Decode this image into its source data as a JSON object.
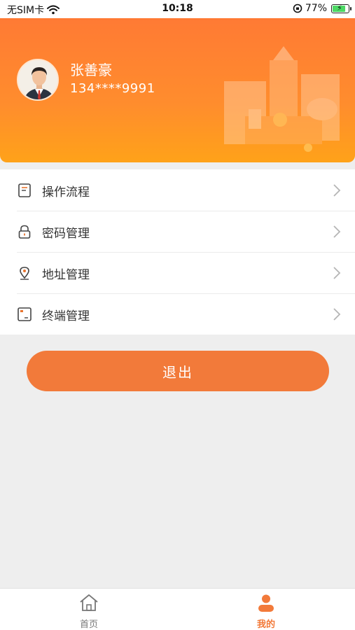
{
  "status_bar": {
    "carrier": "无SIM卡",
    "time": "10:18",
    "battery_percent": "77%",
    "battery_level": 0.77
  },
  "profile": {
    "name": "张善豪",
    "phone": "134****9991"
  },
  "menu": {
    "items": [
      {
        "label": "操作流程",
        "icon": "document-icon"
      },
      {
        "label": "密码管理",
        "icon": "lock-icon"
      },
      {
        "label": "地址管理",
        "icon": "location-pin-icon"
      },
      {
        "label": "终端管理",
        "icon": "terminal-icon"
      }
    ]
  },
  "logout": {
    "label": "退出"
  },
  "tabbar": {
    "tabs": [
      {
        "label": "首页",
        "icon": "home-icon",
        "active": false
      },
      {
        "label": "我的",
        "icon": "person-icon",
        "active": true
      }
    ]
  },
  "colors": {
    "accent": "#f27a3a",
    "header_top": "#ff7a34",
    "header_bottom": "#ffa219",
    "background": "#eeeeee"
  }
}
